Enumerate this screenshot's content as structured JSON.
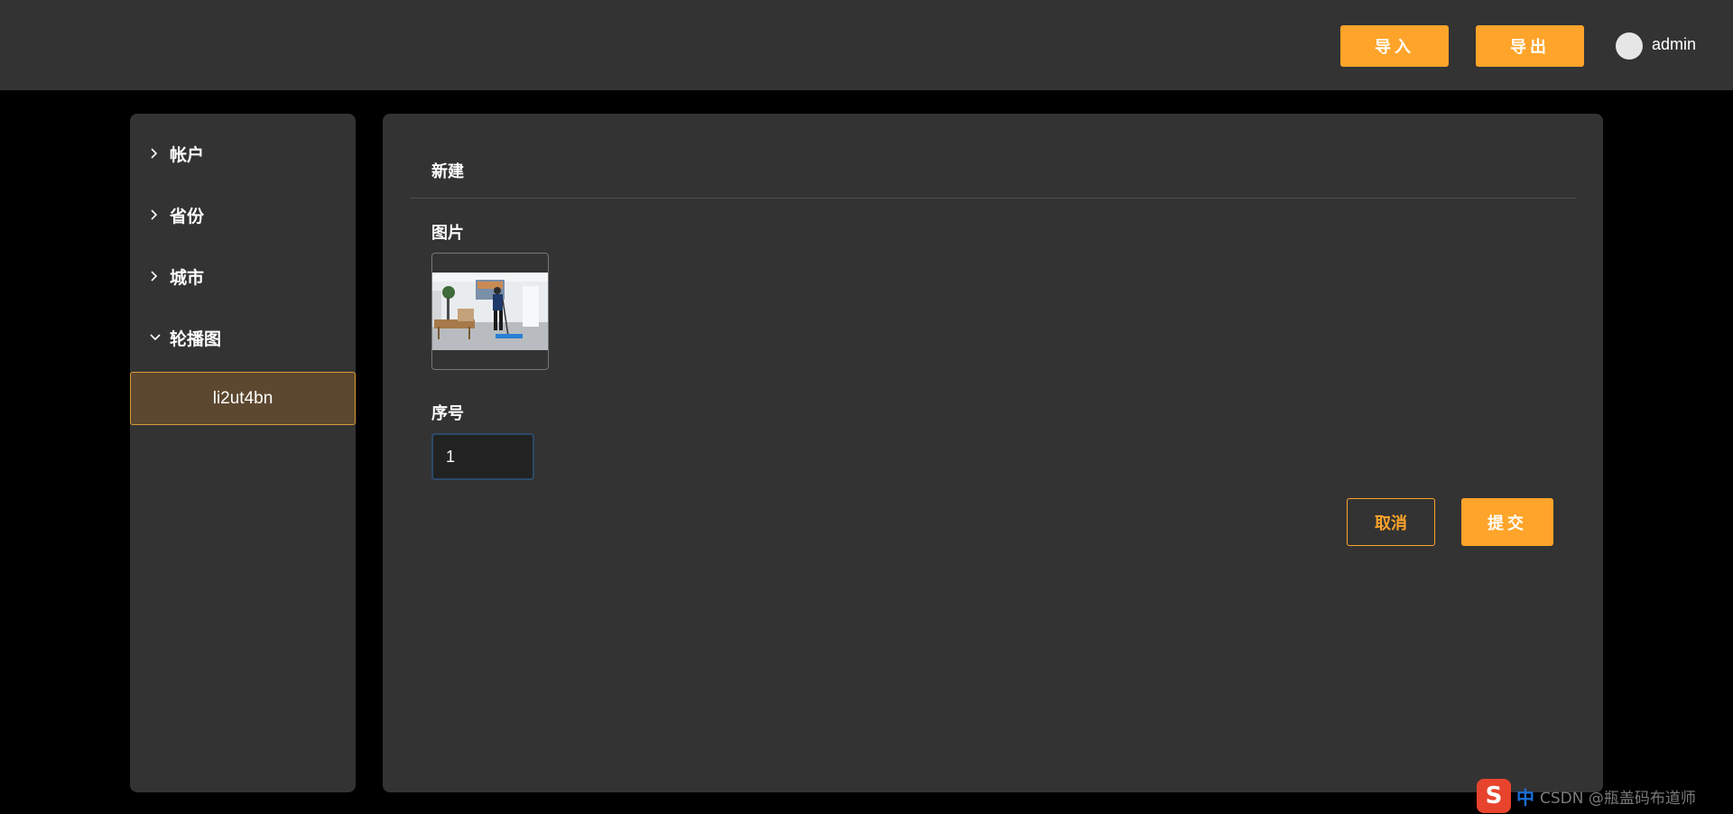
{
  "header": {
    "import_label": "导入",
    "export_label": "导出",
    "username": "admin"
  },
  "sidebar": {
    "items": [
      {
        "label": "帐户",
        "icon": "chevron-right-icon"
      },
      {
        "label": "省份",
        "icon": "chevron-right-icon"
      },
      {
        "label": "城市",
        "icon": "chevron-right-icon"
      },
      {
        "label": "轮播图",
        "icon": "chevron-down-icon"
      }
    ],
    "sub_items": [
      {
        "label": "li2ut4bn",
        "selected": true
      }
    ]
  },
  "form": {
    "title": "新建",
    "image_label": "图片",
    "order_label": "序号",
    "order_value": "1",
    "cancel_label": "取消",
    "submit_label": "提交"
  },
  "ime": {
    "logo": "S",
    "lang": "中",
    "watermark": "CSDN @瓶盖码布道师"
  },
  "colors": {
    "accent": "#ffa42a",
    "panel": "#333333",
    "background": "#000000",
    "selected_bg": "#5c4830"
  }
}
